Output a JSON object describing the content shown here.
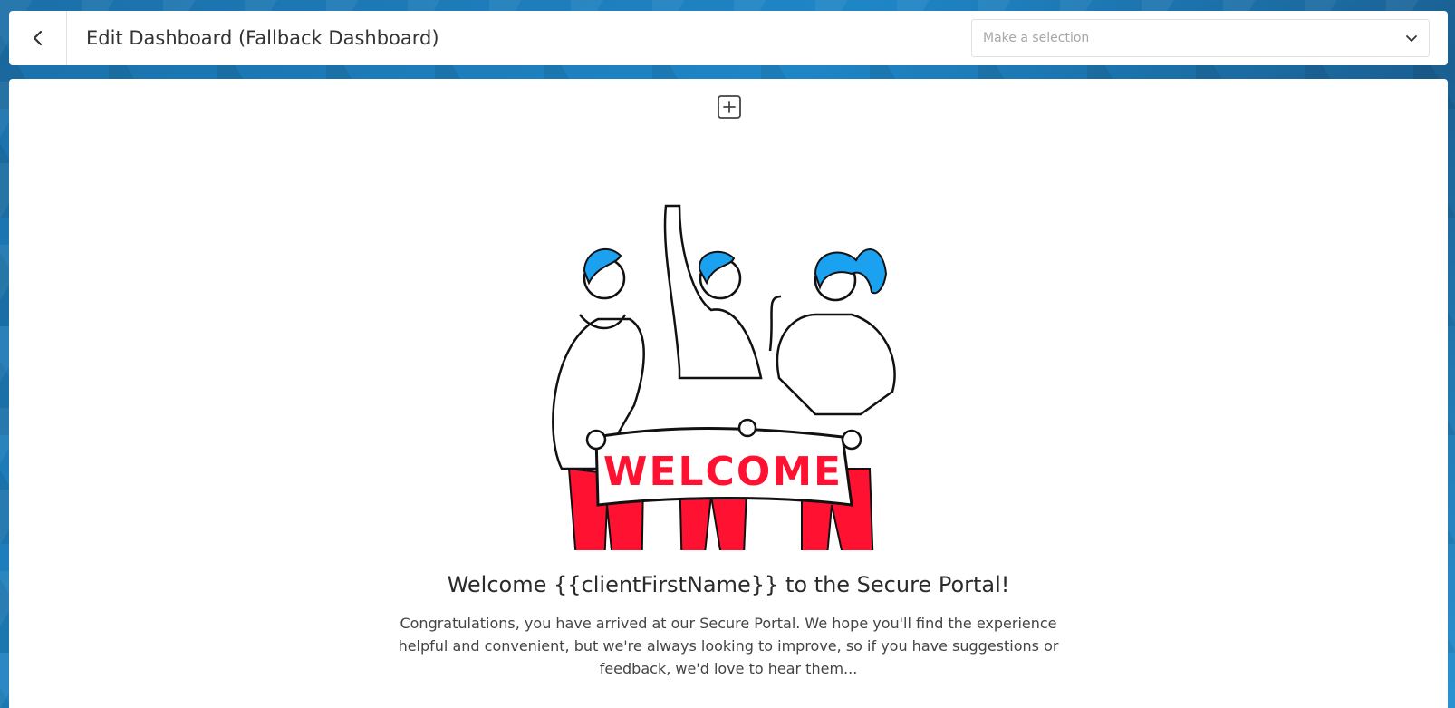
{
  "header": {
    "title": "Edit Dashboard (Fallback Dashboard)",
    "back_icon": "chevron-left-icon",
    "selection_placeholder": "Make a selection",
    "selection_icon": "chevron-down-icon"
  },
  "main": {
    "add_icon": "plus-square-icon",
    "illustration": {
      "banner_text": "WELCOME",
      "accent_color": "#ff1231",
      "hair_color": "#1aa1f0"
    },
    "heading": "Welcome {{clientFirstName}} to the Secure Portal!",
    "body": "Congratulations, you have arrived at our Secure Portal. We hope you'll find the experience helpful and convenient, but we're always looking to improve, so if you have suggestions or feedback, we'd love to hear them..."
  }
}
